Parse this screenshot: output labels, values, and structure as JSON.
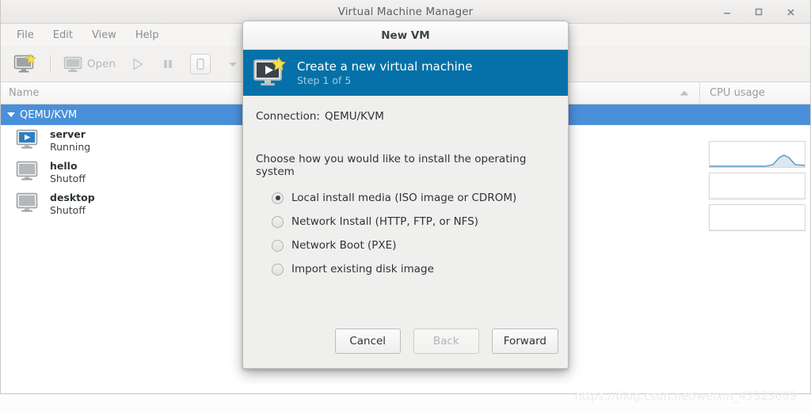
{
  "window": {
    "title": "Virtual Machine Manager",
    "controls": [
      {
        "name": "minimize-button",
        "glyph": "minimize"
      },
      {
        "name": "maximize-button",
        "glyph": "maximize"
      },
      {
        "name": "close-button",
        "glyph": "close"
      }
    ]
  },
  "menubar": {
    "items": [
      "File",
      "Edit",
      "View",
      "Help"
    ]
  },
  "toolbar": {
    "new_vm_icon": "new-vm-icon",
    "open_label": "Open",
    "open_icon": "monitor-icon",
    "run_icon": "play-icon",
    "pause_icon": "pause-icon",
    "shutdown_icon": "shutdown-icon",
    "menu_icon": "chevron-down-icon"
  },
  "list": {
    "columns": {
      "name": "Name",
      "cpu": "CPU usage",
      "sort_icon": "sort-ascending-icon"
    },
    "connection": {
      "label": "QEMU/KVM",
      "expander": "triangle-down-icon",
      "selected": true
    },
    "vms": [
      {
        "name": "server",
        "state": "Running",
        "icon": "vm-running-icon",
        "cpu_spike": true
      },
      {
        "name": "hello",
        "state": "Shutoff",
        "icon": "vm-shutoff-icon",
        "cpu_spike": false
      },
      {
        "name": "desktop",
        "state": "Shutoff",
        "icon": "vm-shutoff-icon",
        "cpu_spike": false
      }
    ]
  },
  "dialog": {
    "title": "New VM",
    "banner": {
      "icon": "new-vm-banner-icon",
      "heading": "Create a new virtual machine",
      "step": "Step 1 of 5",
      "bg_color": "#0571a8"
    },
    "connection_label": "Connection:",
    "connection_value": "QEMU/KVM",
    "prompt": "Choose how you would like to install the operating system",
    "options": [
      {
        "label": "Local install media (ISO image or CDROM)",
        "checked": true
      },
      {
        "label": "Network Install (HTTP, FTP, or NFS)",
        "checked": false
      },
      {
        "label": "Network Boot (PXE)",
        "checked": false
      },
      {
        "label": "Import existing disk image",
        "checked": false
      }
    ],
    "buttons": {
      "cancel": "Cancel",
      "back": "Back",
      "back_disabled": true,
      "forward": "Forward"
    }
  },
  "watermark": "https://blog.csdn.net/weixin_43323669",
  "colors": {
    "accent": "#0571a8",
    "selection": "#4a90d9",
    "chrome": "#f6f5f4"
  }
}
